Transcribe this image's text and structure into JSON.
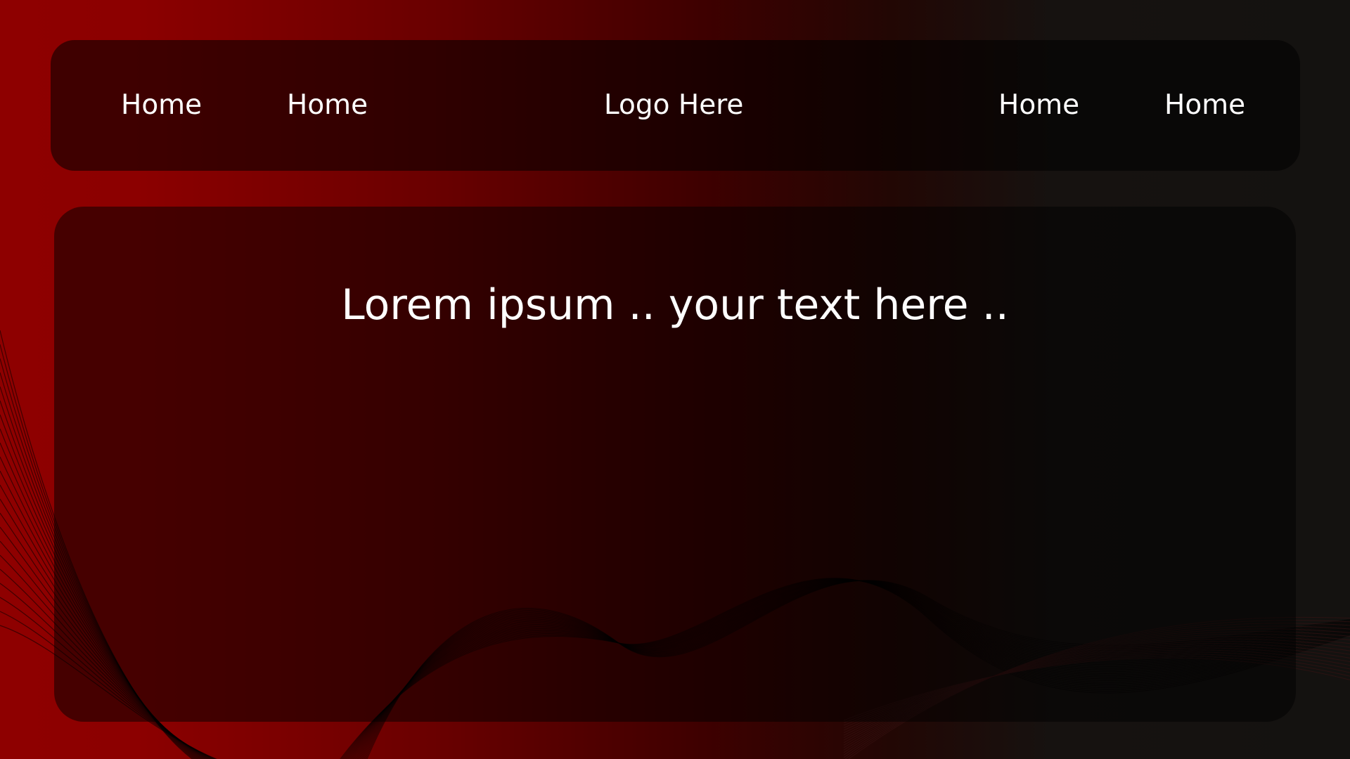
{
  "nav": {
    "items": [
      {
        "label": "Home"
      },
      {
        "label": "Home"
      },
      {
        "label": "Home"
      },
      {
        "label": "Home"
      }
    ],
    "logo_text": "Logo Here"
  },
  "main": {
    "headline": "Lorem ipsum .. your text here .."
  },
  "colors": {
    "background_start": "#8e0000",
    "background_end": "#141210",
    "text": "#ffffff"
  }
}
